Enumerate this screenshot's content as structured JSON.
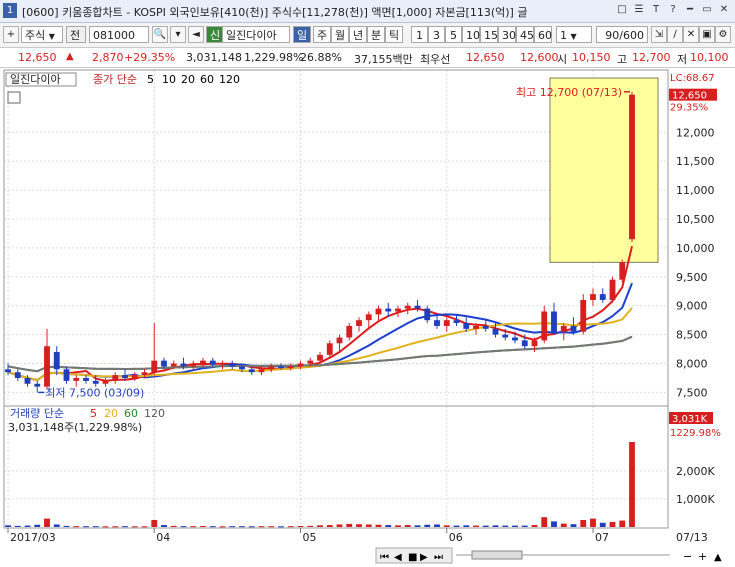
{
  "titlebar": {
    "window_number": "1",
    "title": "[0600] 키움종합차트 - KOSPI 외국인보유[410(천)] 주식수[11,278(천)] 액면[1,000] 자본금[113(억)] 글",
    "buttons": [
      "□",
      "☰",
      "T",
      "?",
      "━",
      "▭",
      "✕"
    ]
  },
  "toolbar": {
    "market": "주식",
    "period_type": "전",
    "code": "081000",
    "name": "일진다이아",
    "period_badge": "일",
    "timeframes": [
      "주",
      "월",
      "년",
      "분",
      "틱"
    ],
    "intervals": [
      "1",
      "3",
      "5",
      "10",
      "15",
      "30",
      "45",
      "60"
    ],
    "interval_value": "1",
    "count": "90/600"
  },
  "quote": {
    "price": "12,650",
    "change": "2,870",
    "change_pct": "+29.35%",
    "volume": "3,031,148",
    "volume_pct": "1,229.98%",
    "rate": "26.88%",
    "amount": "37,155백만",
    "best_ask_label": "최우선",
    "ask": "12,650",
    "bid": "12,600",
    "open_label": "시",
    "open": "10,150",
    "high_label": "고",
    "high": "12,700",
    "low_label": "저",
    "low": "10,100"
  },
  "price_panel": {
    "name": "일진다이아",
    "indicator_label": "종가 단순",
    "ma_periods": [
      "5",
      "10",
      "20",
      "60",
      "120"
    ],
    "ma_colors": [
      "#e01b1b",
      "#1c3fd0",
      "#e0b21e",
      "#1b8f2b",
      "#777777"
    ],
    "max_annotation": "최고 12,700 (07/13)",
    "min_annotation": "최저 7,500 (03/09)",
    "lc_label": "LC:68.67",
    "last_price_tag": "12,650",
    "last_pct_tag": "29.35%",
    "y_ticks": [
      "12,000",
      "11,500",
      "11,000",
      "10,500",
      "10,000",
      "9,500",
      "9,000",
      "8,500",
      "8,000",
      "7,500"
    ]
  },
  "volume_panel": {
    "title": "거래량 단순",
    "ma_periods": [
      "5",
      "20",
      "60",
      "120"
    ],
    "readout": "3,031,148주(1,229.98%)",
    "last_tag": "3,031K",
    "last_pct_tag": "1229.98%",
    "y_ticks": [
      "2,000K",
      "1,000K"
    ]
  },
  "x_axis": {
    "labels": [
      "2017/03",
      "04",
      "05",
      "06",
      "07"
    ],
    "right_label": "07/13"
  },
  "chart_data": {
    "type": "candlestick",
    "title": "일진다이아",
    "x_labels": [
      "2017/03",
      "04",
      "05",
      "06",
      "07"
    ],
    "ylim": [
      7300,
      12800
    ],
    "volume_ylim": [
      0,
      3100000
    ],
    "up_color": "#d81f1f",
    "down_color": "#1f3fbf",
    "candles": [
      [
        7900,
        8000,
        7800,
        7850
      ],
      [
        7850,
        7900,
        7700,
        7750
      ],
      [
        7750,
        7800,
        7600,
        7650
      ],
      [
        7650,
        7700,
        7500,
        7600
      ],
      [
        7600,
        8600,
        7550,
        8300
      ],
      [
        8200,
        8300,
        7800,
        7900
      ],
      [
        7900,
        7950,
        7650,
        7700
      ],
      [
        7700,
        7800,
        7600,
        7750
      ],
      [
        7750,
        7800,
        7650,
        7700
      ],
      [
        7700,
        7800,
        7600,
        7650
      ],
      [
        7650,
        7750,
        7600,
        7700
      ],
      [
        7700,
        7850,
        7650,
        7800
      ],
      [
        7800,
        7900,
        7700,
        7750
      ],
      [
        7750,
        7850,
        7700,
        7800
      ],
      [
        7800,
        7900,
        7750,
        7850
      ],
      [
        7850,
        8700,
        7800,
        8050
      ],
      [
        8050,
        8100,
        7900,
        7950
      ],
      [
        7950,
        8050,
        7900,
        8000
      ],
      [
        8000,
        8100,
        7900,
        7950
      ],
      [
        7950,
        8050,
        7900,
        8000
      ],
      [
        8000,
        8100,
        7950,
        8050
      ],
      [
        8050,
        8100,
        7950,
        7980
      ],
      [
        7980,
        8050,
        7900,
        8000
      ],
      [
        8000,
        8050,
        7900,
        7950
      ],
      [
        7950,
        8000,
        7850,
        7900
      ],
      [
        7900,
        7950,
        7800,
        7850
      ],
      [
        7850,
        7950,
        7800,
        7900
      ],
      [
        7900,
        8000,
        7850,
        7950
      ],
      [
        7950,
        8000,
        7900,
        7920
      ],
      [
        7920,
        8000,
        7880,
        7950
      ],
      [
        7950,
        8050,
        7900,
        8000
      ],
      [
        8000,
        8100,
        7950,
        8050
      ],
      [
        8050,
        8200,
        8000,
        8150
      ],
      [
        8150,
        8400,
        8100,
        8350
      ],
      [
        8350,
        8500,
        8200,
        8450
      ],
      [
        8450,
        8700,
        8400,
        8650
      ],
      [
        8650,
        8800,
        8550,
        8750
      ],
      [
        8750,
        8900,
        8600,
        8850
      ],
      [
        8850,
        9000,
        8750,
        8950
      ],
      [
        8950,
        9050,
        8800,
        8900
      ],
      [
        8900,
        9000,
        8800,
        8950
      ],
      [
        8950,
        9050,
        8850,
        9000
      ],
      [
        9000,
        9100,
        8900,
        8950
      ],
      [
        8950,
        9000,
        8700,
        8750
      ],
      [
        8750,
        8850,
        8600,
        8650
      ],
      [
        8650,
        8800,
        8550,
        8750
      ],
      [
        8750,
        8850,
        8650,
        8700
      ],
      [
        8700,
        8800,
        8550,
        8600
      ],
      [
        8600,
        8700,
        8500,
        8650
      ],
      [
        8650,
        8750,
        8550,
        8600
      ],
      [
        8600,
        8700,
        8450,
        8500
      ],
      [
        8500,
        8600,
        8400,
        8450
      ],
      [
        8450,
        8550,
        8350,
        8400
      ],
      [
        8400,
        8500,
        8250,
        8300
      ],
      [
        8300,
        8450,
        8200,
        8400
      ],
      [
        8400,
        9000,
        8350,
        8900
      ],
      [
        8900,
        9050,
        8500,
        8550
      ],
      [
        8550,
        8700,
        8400,
        8650
      ],
      [
        8650,
        8800,
        8500,
        8550
      ],
      [
        8550,
        9200,
        8500,
        9100
      ],
      [
        9100,
        9300,
        9000,
        9200
      ],
      [
        9200,
        9300,
        9050,
        9100
      ],
      [
        9100,
        9500,
        9050,
        9450
      ],
      [
        9450,
        9800,
        9400,
        9750
      ],
      [
        10150,
        12700,
        10100,
        12650
      ]
    ],
    "volumes": [
      60,
      40,
      50,
      80,
      300,
      90,
      40,
      30,
      30,
      30,
      25,
      25,
      30,
      25,
      25,
      250,
      70,
      40,
      30,
      30,
      35,
      30,
      25,
      30,
      30,
      25,
      30,
      30,
      25,
      30,
      35,
      40,
      60,
      70,
      90,
      110,
      100,
      90,
      80,
      70,
      60,
      70,
      60,
      80,
      90,
      60,
      50,
      60,
      50,
      50,
      60,
      50,
      50,
      50,
      70,
      350,
      200,
      120,
      100,
      250,
      300,
      150,
      180,
      230,
      3031
    ]
  }
}
